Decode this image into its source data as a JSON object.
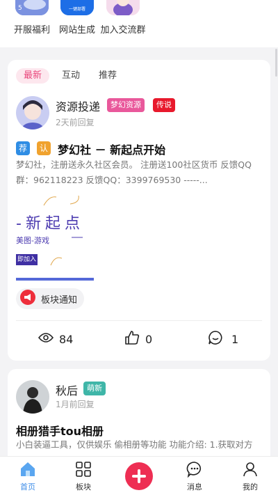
{
  "quick_links": [
    {
      "label": "开服福利",
      "icon": "gift-app-icon"
    },
    {
      "label": "网站生成",
      "icon": "website-builder-app-icon",
      "icon_text": "一键部署"
    },
    {
      "label": "加入交流群",
      "icon": "anime-group-app-icon"
    }
  ],
  "feed": {
    "tabs": [
      "最新",
      "互动",
      "推荐"
    ],
    "active_tab": "最新",
    "post1": {
      "author": "资源投递",
      "badges": [
        {
          "text": "梦幻资源",
          "color": "#e9589b"
        },
        {
          "text": "传说",
          "color": "#e8192c"
        }
      ],
      "time": "2天前回复",
      "tags": [
        {
          "text": "荐",
          "color": "#2f8de4"
        },
        {
          "text": "认",
          "color": "#f0a22e"
        }
      ],
      "title": "梦幻社 － 新起点开始",
      "body_line1": "梦幻社，注册送永久社区会员。 注册送100社区货币 反馈QQ",
      "body_line2": "群：962118223 反馈QQ：3399769530 -----...",
      "banner": {
        "headline": "-新起点",
        "subtitle": "美图-游戏",
        "join": "即加入"
      },
      "section": "板块通知",
      "stats": {
        "views": "84",
        "likes": "0",
        "comments": "1"
      }
    },
    "post2": {
      "author": "秋后",
      "badges": [
        {
          "text": "萌新",
          "color": "#3fb6a8"
        }
      ],
      "time": "1月前回复",
      "title": "相册猎手tou相册",
      "body_line1": "小白装逼工具，仅供娱乐 偷相册等功能 功能介绍: 1.获取对方"
    }
  },
  "bottom_nav": {
    "items": [
      {
        "label": "首页",
        "icon": "home-icon",
        "active": true
      },
      {
        "label": "板块",
        "icon": "grid-icon",
        "active": false
      },
      {
        "label": "",
        "icon": "plus-icon",
        "active": false
      },
      {
        "label": "消息",
        "icon": "chat-bubble-icon",
        "active": false
      },
      {
        "label": "我的",
        "icon": "person-icon",
        "active": false
      }
    ],
    "active_color": "#3f8ee8",
    "plus_color": "#ee2e53"
  }
}
